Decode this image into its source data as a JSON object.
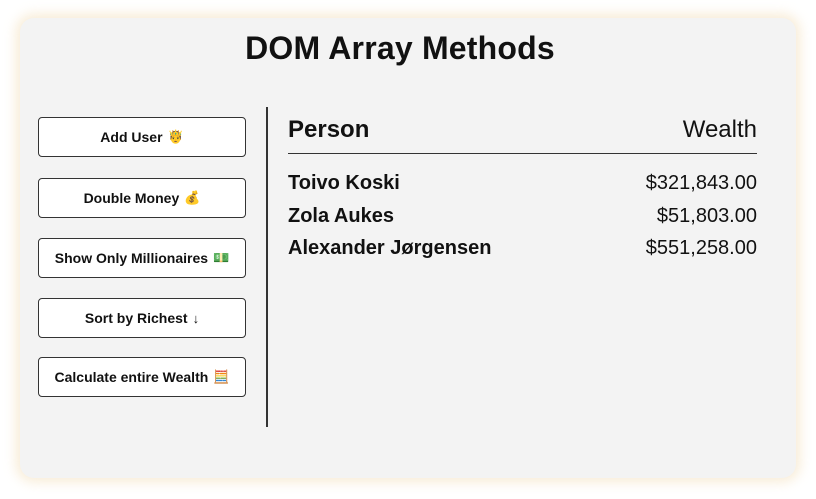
{
  "page": {
    "title": "DOM Array Methods"
  },
  "sidebar": {
    "buttons": [
      {
        "label": "Add User",
        "emoji": "🤴"
      },
      {
        "label": "Double Money",
        "emoji": "💰"
      },
      {
        "label": "Show Only Millionaires",
        "emoji": "💵"
      },
      {
        "label": "Sort by Richest",
        "emoji": "↓"
      },
      {
        "label": "Calculate entire Wealth",
        "emoji": "🧮"
      }
    ]
  },
  "main": {
    "header": {
      "person": "Person",
      "wealth": "Wealth"
    },
    "rows": [
      {
        "name": "Toivo Koski",
        "money": "$321,843.00"
      },
      {
        "name": "Zola Aukes",
        "money": "$51,803.00"
      },
      {
        "name": "Alexander Jørgensen",
        "money": "$551,258.00"
      }
    ]
  }
}
